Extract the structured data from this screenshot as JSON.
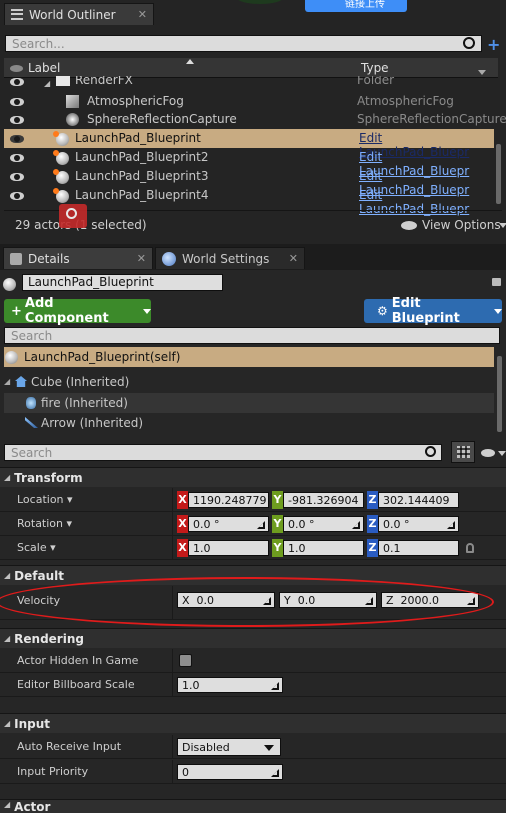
{
  "world_outliner": {
    "tab_title": "World Outliner",
    "search_placeholder": "Search...",
    "col_label": "Label",
    "col_type": "Type",
    "rows": [
      {
        "label": "RenderFX",
        "type": "Folder"
      },
      {
        "label": "AtmosphericFog",
        "type": "AtmosphericFog"
      },
      {
        "label": "SphereReflectionCapture",
        "type": "SphereReflectionCapture"
      },
      {
        "label": "LaunchPad_Blueprint",
        "type": "Edit LaunchPad_Bluepr"
      },
      {
        "label": "LaunchPad_Blueprint2",
        "type": "Edit LaunchPad_Bluepr"
      },
      {
        "label": "LaunchPad_Blueprint3",
        "type": "Edit LaunchPad_Bluepr"
      },
      {
        "label": "LaunchPad_Blueprint4",
        "type": "Edit LaunchPad_Bluepr"
      }
    ],
    "footer_count": "29 actors (1 selected)",
    "view_options": "View Options"
  },
  "top_button": "链接上传",
  "details": {
    "tab_details": "Details",
    "tab_world_settings": "World Settings",
    "actor_name": "LaunchPad_Blueprint",
    "add_component": "Add Component",
    "edit_blueprint": "Edit Blueprint",
    "comp_search_placeholder": "Search",
    "components": {
      "self": "LaunchPad_Blueprint(self)",
      "cube": "Cube (Inherited)",
      "fire": "fire (Inherited)",
      "arrow": "Arrow (Inherited)"
    },
    "prop_search_placeholder": "Search",
    "transform": {
      "header": "Transform",
      "location_label": "Location",
      "location": {
        "x": "1190.248779",
        "y": "-981.326904",
        "z": "302.144409"
      },
      "rotation_label": "Rotation",
      "rotation": {
        "x": "0.0 °",
        "y": "0.0 °",
        "z": "0.0 °"
      },
      "scale_label": "Scale",
      "scale": {
        "x": "1.0",
        "y": "1.0",
        "z": "0.1"
      }
    },
    "default": {
      "header": "Default",
      "velocity_label": "Velocity",
      "velocity": {
        "x_label": "X",
        "x": "0.0",
        "y_label": "Y",
        "y": "0.0",
        "z_label": "Z",
        "z": "2000.0"
      }
    },
    "rendering": {
      "header": "Rendering",
      "hidden_label": "Actor Hidden In Game",
      "billboard_label": "Editor Billboard Scale",
      "billboard_value": "1.0"
    },
    "input": {
      "header": "Input",
      "auto_receive_label": "Auto Receive Input",
      "auto_receive_value": "Disabled",
      "priority_label": "Input Priority",
      "priority_value": "0"
    },
    "actor_header": "Actor"
  },
  "axis_letters": {
    "x": "X",
    "y": "Y",
    "z": "Z"
  },
  "colors": {
    "selection": "#c8ab82",
    "add_component": "#3c8a2a",
    "edit_blueprint": "#2d6bb0",
    "annotation": "#e01b1b"
  }
}
